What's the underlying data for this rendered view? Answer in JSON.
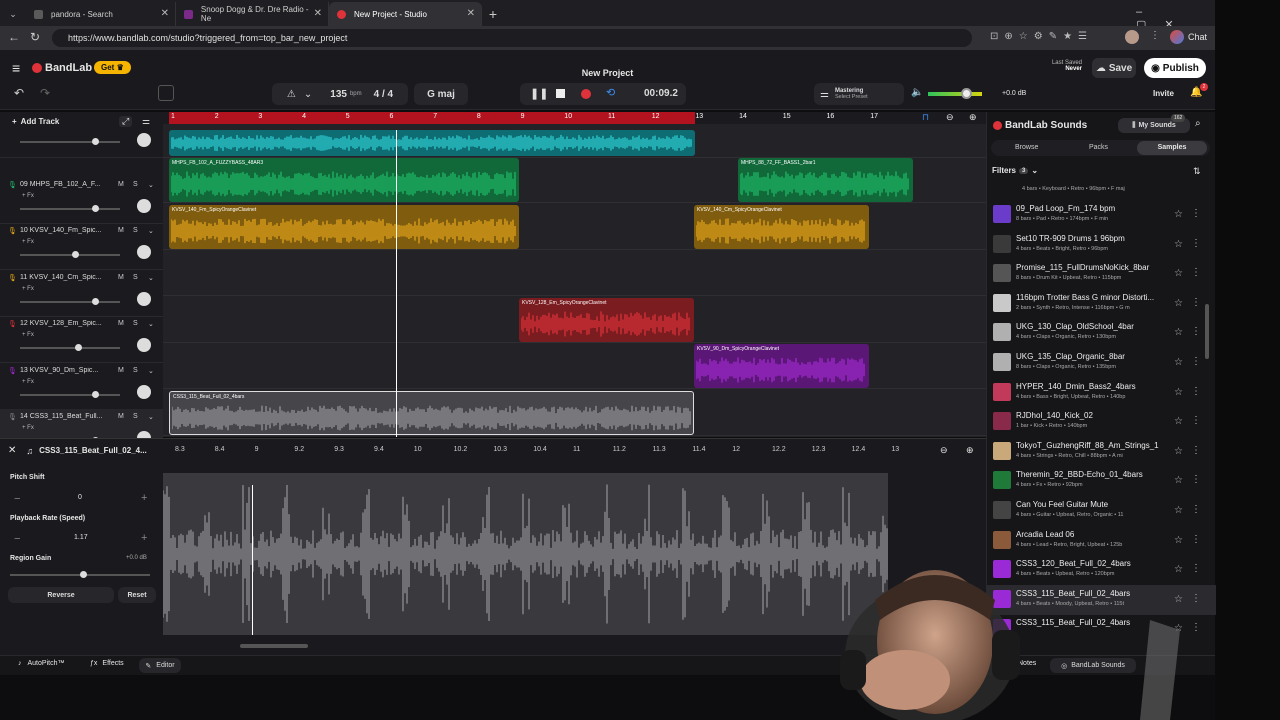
{
  "browser": {
    "tabs": [
      {
        "title": "pandora - Search",
        "color": "#5a5a5a"
      },
      {
        "title": "Snoop Dogg & Dr. Dre Radio - Ne",
        "color": "#7b2a8a"
      },
      {
        "title": "New Project - Studio",
        "color": "#e0323a"
      }
    ],
    "url": "https://www.bandlab.com/studio?triggered_from=top_bar_new_project",
    "chat_label": "Chat"
  },
  "header": {
    "brand": "BandLab",
    "get_label": "Get",
    "project_title": "New Project",
    "bpm_value": "135",
    "bpm_unit": "bpm",
    "time_signature": "4 / 4",
    "key": "G maj",
    "time_display": "00:09.2",
    "mastering_title": "Mastering",
    "mastering_sub": "Select Preset",
    "volume_db": "+0.0 dB",
    "last_saved_label": "Last Saved",
    "last_saved_value": "Never",
    "save_label": "Save",
    "publish_label": "Publish",
    "invite_label": "Invite",
    "notif_count": "2"
  },
  "tracks_toolbar": {
    "add_track": "Add Track"
  },
  "ruler_numbers": [
    "1",
    "2",
    "3",
    "4",
    "5",
    "6",
    "7",
    "8",
    "9",
    "10",
    "11",
    "12",
    "13",
    "14",
    "15",
    "16",
    "17"
  ],
  "tracks": [
    {
      "num": "",
      "name": "",
      "fx": "",
      "color": "#14b3b8",
      "knob": 0.72
    },
    {
      "num": "09",
      "name": "MHPS_FB_102_A_F...",
      "fx": "+ Fx",
      "color": "#1fbf6a",
      "knob": 0.72
    },
    {
      "num": "10",
      "name": "KVSV_140_Fm_Spic...",
      "fx": "+ Fx",
      "color": "#e8a91a",
      "knob": 0.52
    },
    {
      "num": "11",
      "name": "KVSV_140_Cm_Spic...",
      "fx": "+ Fx",
      "color": "#e8a91a",
      "knob": 0.72
    },
    {
      "num": "12",
      "name": "KVSV_128_Em_Spic...",
      "fx": "+ Fx",
      "color": "#e0323a",
      "knob": 0.55
    },
    {
      "num": "13",
      "name": "KVSV_90_Dm_Spic...",
      "fx": "+ Fx",
      "color": "#a62ad6",
      "knob": 0.72
    },
    {
      "num": "14",
      "name": "CSS3_115_Beat_Full...",
      "fx": "+ Fx",
      "color": "#8a8a8a",
      "knob": 0.72
    }
  ],
  "clips": [
    {
      "lane": 1,
      "label": "MHPS_FB_102_A_FUZZYBASS_48AR3",
      "color": "#1fbf6a"
    },
    {
      "lane": 1,
      "label": "MHPS_88_72_FF_BASS1_2bar1",
      "color": "#1fbf6a"
    },
    {
      "lane": 2,
      "label": "KVSV_140_Fm_SpicyOrangeClavinet",
      "color": "#e8a91a"
    },
    {
      "lane": 2,
      "label": "KVSV_140_Cm_SpicyOrangeClavinet",
      "color": "#e8a91a"
    },
    {
      "lane": 4,
      "label": "KVSV_128_Em_SpicyOrangeClavinet",
      "color": "#e0323a"
    },
    {
      "lane": 5,
      "label": "KVSV_90_Dm_SpicyOrangeClavinet",
      "color": "#a62ad6"
    },
    {
      "lane": 6,
      "label": "CSS3_115_Beat_Full_02_4bars",
      "color": "#8a8a8a"
    }
  ],
  "editor": {
    "clip_name": "CSS3_115_Beat_Full_02_4...",
    "ruler": [
      "8.3",
      "8.4",
      "9",
      "9.2",
      "9.3",
      "9.4",
      "10",
      "10.2",
      "10.3",
      "10.4",
      "11",
      "11.2",
      "11.3",
      "11.4",
      "12",
      "12.2",
      "12.3",
      "12.4",
      "13"
    ],
    "pitch_label": "Pitch Shift",
    "pitch_value": "0",
    "rate_label": "Playback Rate (Speed)",
    "rate_value": "1.17",
    "gain_label": "Region Gain",
    "gain_value": "+0.0 dB",
    "reverse_label": "Reverse",
    "reset_label": "Reset"
  },
  "bottom_bar": {
    "autopitch": "AutoPitch™",
    "effects": "Effects",
    "editor": "Editor",
    "notes": "Notes",
    "sounds": "BandLab Sounds"
  },
  "sounds_panel": {
    "title": "BandLab Sounds",
    "my_sounds": "My Sounds",
    "badge": "162",
    "tabs": [
      "Browse",
      "Packs",
      "Samples"
    ],
    "filters_label": "Filters",
    "filters_count": "3",
    "first_meta": "4 bars • Keyboard • Retro • 96bpm • F maj",
    "items": [
      {
        "title": "09_Pad Loop_Fm_174 bpm",
        "meta": "8 bars • Pad • Retro • 174bpm • F min",
        "thumb": "#6a3cc9"
      },
      {
        "title": "Set10 TR-909 Drums 1 96bpm",
        "meta": "4 bars • Beats • Bright, Retro • 96bpm",
        "thumb": "#3a3a3a"
      },
      {
        "title": "Promise_115_FullDrumsNoKick_8bar",
        "meta": "8 bars • Drum Kit • Upbeat, Retro • 115bpm",
        "thumb": "#555555"
      },
      {
        "title": "116bpm Trotter Bass G minor Distorti...",
        "meta": "2 bars • Synth • Retro, Intense • 116bpm • G m",
        "thumb": "#c9c9c9"
      },
      {
        "title": "UKG_130_Clap_OldSchool_4bar",
        "meta": "4 bars • Claps • Organic, Retro • 130bpm",
        "thumb": "#b0b0b0"
      },
      {
        "title": "UKG_135_Clap_Organic_8bar",
        "meta": "8 bars • Claps • Organic, Retro • 135bpm",
        "thumb": "#b0b0b0"
      },
      {
        "title": "HYPER_140_Dmin_Bass2_4bars",
        "meta": "4 bars • Bass • Bright, Upbeat, Retro • 140bp",
        "thumb": "#c23a5a"
      },
      {
        "title": "RJDhol_140_Kick_02",
        "meta": "1 bar • Kick • Retro • 140bpm",
        "thumb": "#8a2a4a"
      },
      {
        "title": "TokyoT_GuzhengRiff_88_Am_Strings_1",
        "meta": "4 bars • Strings • Retro, Chill • 88bpm • A mi",
        "thumb": "#c9a97a"
      },
      {
        "title": "Theremin_92_BBD-Echo_01_4bars",
        "meta": "4 bars • Fx • Retro • 92bpm",
        "thumb": "#1f7a3a"
      },
      {
        "title": "Can You Feel Guitar Mute",
        "meta": "4 bars • Guitar • Upbeat, Retro, Organic • 11",
        "thumb": "#444444"
      },
      {
        "title": "Arcadia Lead 06",
        "meta": "4 bars • Lead • Retro, Bright, Upbeat • 125b",
        "thumb": "#8a5a3a"
      },
      {
        "title": "CSS3_120_Beat_Full_02_4bars",
        "meta": "4 bars • Beats • Upbeat, Retro • 120bpm",
        "thumb": "#9a2ad6"
      },
      {
        "title": "CSS3_115_Beat_Full_02_4bars",
        "meta": "4 bars • Beats • Moody, Upbeat, Retro • 115t",
        "thumb": "#9a2ad6"
      },
      {
        "title": "CSS3_115_Beat_Full_02_4bars",
        "meta": "",
        "thumb": "#9a2ad6"
      }
    ]
  }
}
